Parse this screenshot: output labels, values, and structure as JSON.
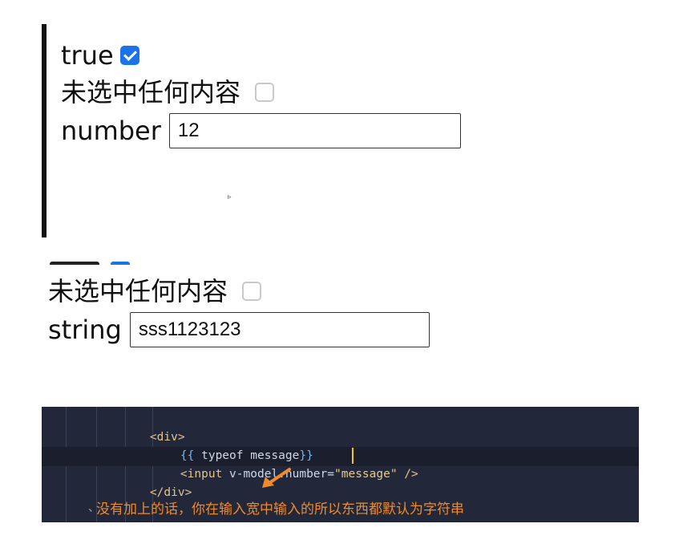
{
  "panel1": {
    "row1_label": "true",
    "row1_checked": true,
    "row2_label": "未选中任何内容",
    "row2_checked": false,
    "row3_label": "number",
    "row3_input_value": "12"
  },
  "panel2": {
    "row2_label": "未选中任何内容",
    "row2_checked": false,
    "row3_label": "string",
    "row3_input_value": "sss1123123"
  },
  "code": {
    "line1": "<div>",
    "line2_open": "{{",
    "line2_expr": " typeof message",
    "line2_close": "}}",
    "line3_tag_open": "<input",
    "line3_attr": " v-model.number",
    "line3_eq": "=",
    "line3_value": "\"message\"",
    "line3_tag_close": " />",
    "line4": "</div>",
    "annotation_mark": "、",
    "annotation": "没有加上的话，你在输入宽中输入的所以东西都默认为字符串"
  },
  "colors": {
    "checkbox_accent": "#1a73e8",
    "code_background": "#22283a",
    "annotation_text": "#f08a2a",
    "text_cursor": "#f5c518"
  }
}
